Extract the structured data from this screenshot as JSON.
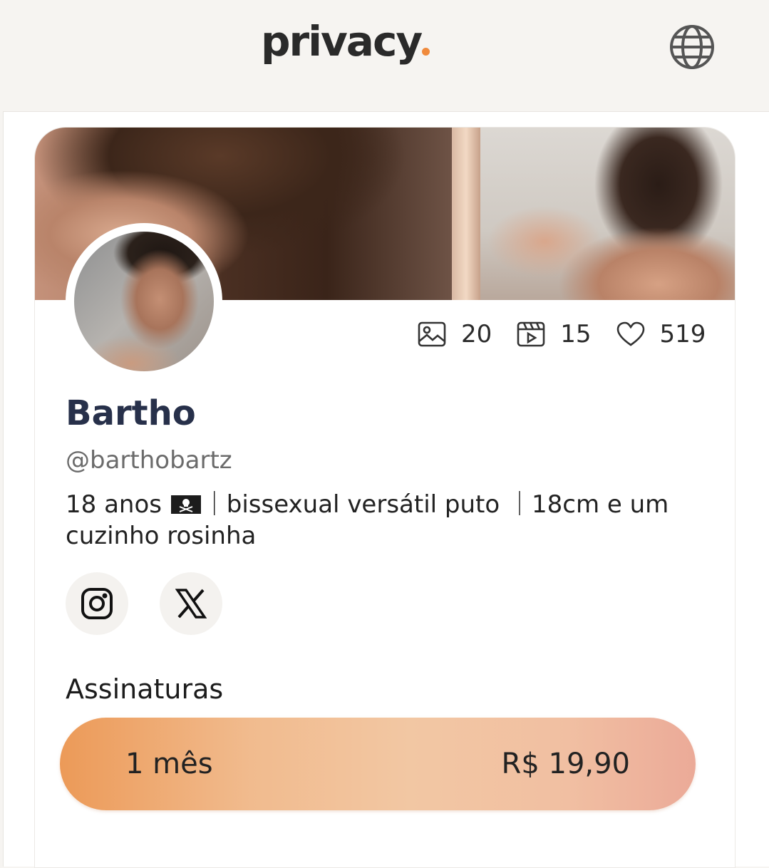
{
  "header": {
    "logo_text": "privacy",
    "logo_dot_color": "#f08a3c",
    "language_icon": "globe-icon"
  },
  "profile": {
    "stats": [
      {
        "icon": "image-icon",
        "value": "20"
      },
      {
        "icon": "video-icon",
        "value": "15"
      },
      {
        "icon": "heart-icon",
        "value": "519"
      }
    ],
    "name": "Bartho",
    "handle": "@barthobartz",
    "bio_part1": "18 anos ",
    "bio_part2": "｜bissexual versátil puto ｜18cm e um cuzinho rosinha",
    "socials": [
      {
        "icon": "instagram-icon"
      },
      {
        "icon": "x-icon"
      }
    ]
  },
  "subscriptions": {
    "title": "Assinaturas",
    "plans": [
      {
        "label": "1 mês",
        "price": "R$ 19,90"
      }
    ]
  },
  "colors": {
    "accent": "#f08a3c",
    "name": "#27304a"
  }
}
